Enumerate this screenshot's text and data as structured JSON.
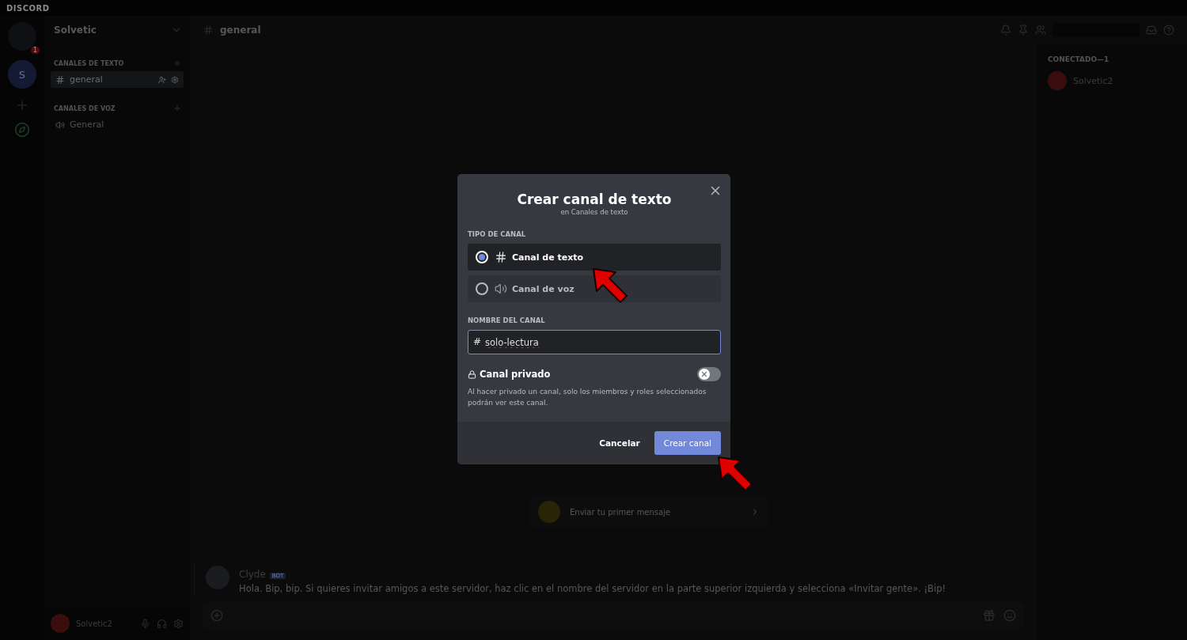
{
  "window": {
    "title": "DISCORD"
  },
  "server": {
    "name": "Solvetic",
    "icon_letter": "S",
    "badge": "1"
  },
  "channel_categories": [
    {
      "name": "CANALES DE TEXTO",
      "channels": [
        {
          "kind": "text",
          "name": "general",
          "selected": true
        }
      ]
    },
    {
      "name": "CANALES DE VOZ",
      "channels": [
        {
          "kind": "voice",
          "name": "General",
          "selected": false
        }
      ]
    }
  ],
  "header": {
    "channel": "general"
  },
  "members": {
    "heading": "CONECTADO—1",
    "list": [
      {
        "name": "Solvetic2"
      }
    ]
  },
  "welcome": {
    "action": "Enviar tu primer mensaje"
  },
  "messages": [
    {
      "author": "Clyde",
      "tag": "BOT",
      "text": "Hola. Bip, bip. Si quieres invitar amigos a este servidor, haz clic en el nombre del servidor en la parte superior izquierda y selecciona «Invitar gente». ¡Bip!"
    }
  ],
  "user_panel": {
    "name": "Solvetic2"
  },
  "modal": {
    "title": "Crear canal de texto",
    "subtitle": "en Canales de texto",
    "type_label": "TIPO DE CANAL",
    "channel_types": [
      {
        "kind": "text",
        "label": "Canal de texto",
        "selected": true
      },
      {
        "kind": "voice",
        "label": "Canal de voz",
        "selected": false
      }
    ],
    "name_label": "NOMBRE DEL CANAL",
    "name_prefix": "#",
    "name_value": "solo-lectura",
    "private": {
      "label": "Canal privado",
      "on": false,
      "description": "Al hacer privado un canal, solo los miembros y roles seleccionados podrán ver este canal."
    },
    "cancel": "Cancelar",
    "create": "Crear canal"
  }
}
